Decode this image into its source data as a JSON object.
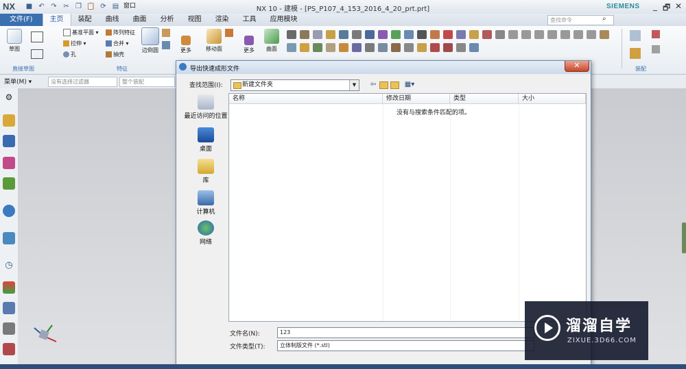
{
  "app": {
    "logo": "NX",
    "window_title": "NX 10 - 建模 - [PS_P107_4_153_2016_4_20_prt.prt]",
    "brand": "SIEMENS",
    "window_controls": [
      "_",
      "🗗",
      "✕"
    ],
    "quick_access": {
      "window_menu": "窗口"
    }
  },
  "menubar": {
    "items": [
      "文件(F)",
      "主页",
      "装配",
      "曲线",
      "曲面",
      "分析",
      "视图",
      "渲染",
      "工具",
      "应用模块"
    ],
    "search_placeholder": "查找命令"
  },
  "ribbon": {
    "sketch": "草图",
    "datum_plane": "基准平面",
    "pattern_feature": "阵列特征",
    "extrude": "拉伸",
    "unite": "合并",
    "hole": "孔",
    "shell": "抽壳",
    "edge_blend": "边倒圆",
    "more1": "更多",
    "move_face": "移动面",
    "more2": "更多",
    "surface": "曲面",
    "more3": "更多",
    "groups": {
      "direct_sketch": "直接草图",
      "feature": "特征",
      "assembly": "装配"
    }
  },
  "filterbar": {
    "menu": "菜单(M)",
    "selection_filter": "没有选择过滤器",
    "assembly_scope": "整个装配"
  },
  "dialog": {
    "title": "导出快速成形文件",
    "look_in_label": "查找范围(I):",
    "look_in_value": "新建文件夹",
    "places": [
      "最近访问的位置",
      "桌面",
      "库",
      "计算机",
      "网络"
    ],
    "columns": [
      "名称",
      "修改日期",
      "类型",
      "大小"
    ],
    "empty_message": "没有与搜索条件匹配的项。",
    "filename_label": "文件名(N):",
    "filename_value": "123",
    "filetype_label": "文件类型(T):",
    "filetype_value": "立体制版文件 (*.stl)"
  },
  "watermark": {
    "title": "溜溜自学",
    "url": "ZIXUE.3D66.COM"
  }
}
